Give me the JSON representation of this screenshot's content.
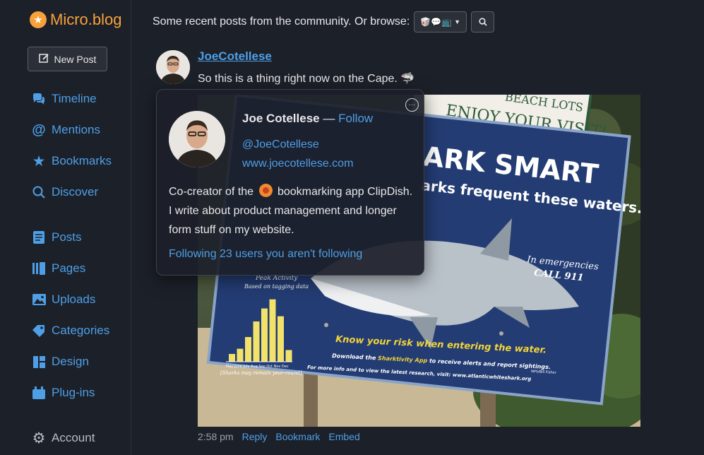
{
  "app": {
    "logo_text": "Micro.blog",
    "accent": "#4e9fe6",
    "brand": "#f7a13a",
    "background": "#1c2029"
  },
  "sidebar": {
    "new_post_label": "New Post",
    "items": [
      {
        "label": "Timeline",
        "icon": "chat-bubbles-icon"
      },
      {
        "label": "Mentions",
        "icon": "at-icon"
      },
      {
        "label": "Bookmarks",
        "icon": "star-icon"
      },
      {
        "label": "Discover",
        "icon": "search-icon"
      },
      {
        "label": "Posts",
        "icon": "document-icon"
      },
      {
        "label": "Pages",
        "icon": "pages-icon"
      },
      {
        "label": "Uploads",
        "icon": "image-icon"
      },
      {
        "label": "Categories",
        "icon": "tag-icon"
      },
      {
        "label": "Design",
        "icon": "layout-icon"
      },
      {
        "label": "Plug-ins",
        "icon": "plugin-icon"
      },
      {
        "label": "Account",
        "icon": "gear-icon"
      }
    ]
  },
  "topbar": {
    "text": "Some recent posts from the community. Or browse:",
    "browse_emoji": "🥡💬📺"
  },
  "post": {
    "author": "JoeCotellese",
    "text": "So this is a thing right now on the Cape. 🦈",
    "time": "2:58 pm",
    "actions": [
      "Reply",
      "Bookmark",
      "Embed"
    ],
    "image": {
      "sign_title_partial": "ARK SMART",
      "sign_subtitle_partial": "arks frequent these waters.",
      "emergency_line1": "In emergencies",
      "emergency_line2": "CALL 911",
      "peak_label": "Peak Activity",
      "peak_sub": "Based on tagging data",
      "chart_months": "May June July Aug Sep Oct Nov Dec",
      "year_round": "[Sharks may remain year-round]",
      "know_risk": "Know your risk when entering the water.",
      "download_line_pre": "Download the ",
      "download_app": "Sharktivity App",
      "download_line_post": " to receive alerts and report sightings.",
      "more_info": "For more info and to view the latest research, visit: www.atlanticwhiteshark.org",
      "credit": "NPS/Bill Fisher",
      "top_sign": "ENJOY YOUR VISIT!",
      "top_sign_partial": "BEACH LOTS",
      "chart_bars": [
        0.12,
        0.2,
        0.38,
        0.62,
        0.82,
        0.96,
        0.7,
        0.18
      ]
    }
  },
  "popover": {
    "name": "Joe Cotellese",
    "dash": " — ",
    "follow_label": "Follow",
    "handle": "@JoeCotellese",
    "website": "www.joecotellese.com",
    "bio_pre": "Co-creator of the ",
    "bio_post": " bookmarking app ClipDish. I write about product management and longer form stuff on my website.",
    "following_text": "Following 23 users you aren't following",
    "more_label": "···"
  }
}
